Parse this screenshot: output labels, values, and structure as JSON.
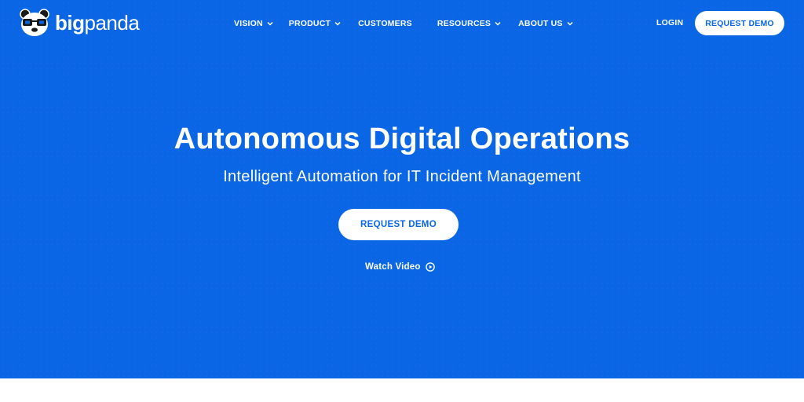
{
  "brand": {
    "name_bold": "big",
    "name_light": "panda",
    "logo_icon": "panda-glasses-logo"
  },
  "nav": {
    "items": [
      {
        "label": "VISION",
        "dropdown": true
      },
      {
        "label": "PRODUCT",
        "dropdown": true
      },
      {
        "label": "CUSTOMERS",
        "dropdown": false
      },
      {
        "label": "RESOURCES",
        "dropdown": true
      },
      {
        "label": "ABOUT US",
        "dropdown": true
      }
    ],
    "login": "LOGIN",
    "request_demo": "REQUEST DEMO"
  },
  "hero": {
    "title": "Autonomous Digital Operations",
    "subtitle": "Intelligent Automation for IT Incident Management",
    "cta": "REQUEST DEMO",
    "watch_video": "Watch Video",
    "watch_icon": "play-circle-icon"
  },
  "colors": {
    "brand_blue": "#0a66e4",
    "white": "#ffffff"
  }
}
